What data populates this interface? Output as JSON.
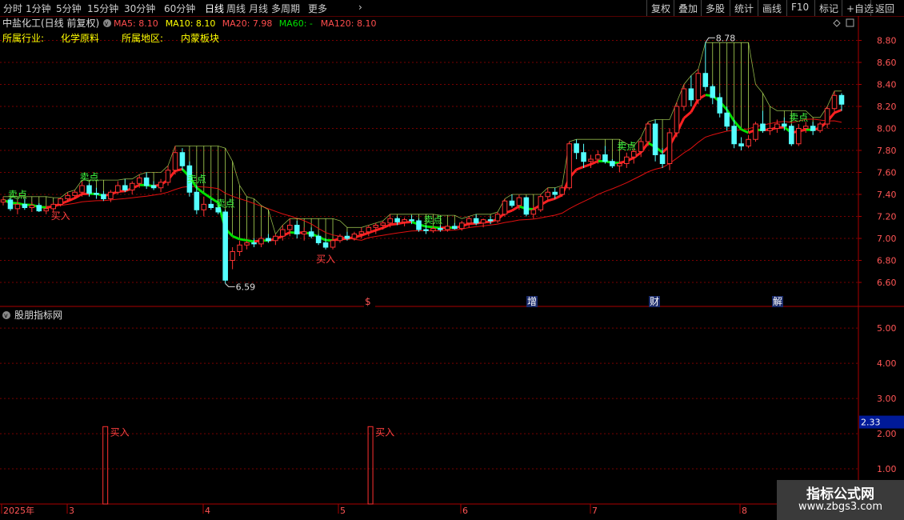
{
  "toolbar": {
    "left": [
      "分时",
      "1分钟",
      "5分钟",
      "15分钟",
      "30分钟",
      "60分钟",
      "日线",
      "周线",
      "月线",
      "多周期",
      "更多"
    ],
    "active": "日线",
    "right": [
      "复权",
      "叠加",
      "多股",
      "统计",
      "画线",
      "F10",
      "标记",
      "+自选",
      "返回"
    ]
  },
  "stock": {
    "title": "中盐化工(日线 前复权)"
  },
  "ma": [
    {
      "label": "MA5: 8.10",
      "color": "#ff4d4d"
    },
    {
      "label": "MA10: 8.10",
      "color": "#ffff00"
    },
    {
      "label": "MA20: 7.98",
      "color": "#ff4d4d"
    },
    {
      "label": "MA60: -",
      "color": "#00e000"
    },
    {
      "label": "MA120: 8.10",
      "color": "#ff4d4d"
    }
  ],
  "info": {
    "industry_label": "所属行业:",
    "industry": "化学原料",
    "region_label": "所属地区:",
    "region": "内蒙板块"
  },
  "price_axis": [
    "8.80",
    "8.60",
    "8.40",
    "8.20",
    "8.00",
    "7.80",
    "7.60",
    "7.40",
    "7.20",
    "7.00",
    "6.80",
    "6.60"
  ],
  "price_range": [
    6.52,
    8.92
  ],
  "high_label": "8.78",
  "low_label": "6.59",
  "signals": {
    "buy": "买入",
    "sell": "卖点"
  },
  "events": [
    "$",
    "增",
    "财",
    "解"
  ],
  "indicator": {
    "title": "股朋指标网",
    "axis": [
      "5.00",
      "4.00",
      "3.00",
      "2.00",
      "1.00"
    ],
    "range": [
      0,
      5.55
    ],
    "current": "2.33"
  },
  "time_axis": [
    "2025年",
    "3",
    "4",
    "5",
    "6",
    "7",
    "8"
  ],
  "watermark": {
    "line1": "指标公式网",
    "line2": "www.zbgs3.com"
  },
  "colors": {
    "up": "#ff3232",
    "down": "#54ffff",
    "ma_red": "#ff2020",
    "ma_green": "#00e000",
    "grid": "#7a0000",
    "band": "#ccff66"
  },
  "chart_data": {
    "type": "candlestick",
    "ohlc": [
      [
        7.33,
        7.38,
        7.3,
        7.35
      ],
      [
        7.35,
        7.37,
        7.25,
        7.27
      ],
      [
        7.27,
        7.34,
        7.22,
        7.31
      ],
      [
        7.31,
        7.36,
        7.26,
        7.28
      ],
      [
        7.28,
        7.33,
        7.24,
        7.3
      ],
      [
        7.3,
        7.32,
        7.24,
        7.25
      ],
      [
        7.25,
        7.28,
        7.22,
        7.27
      ],
      [
        7.27,
        7.33,
        7.24,
        7.31
      ],
      [
        7.31,
        7.37,
        7.29,
        7.36
      ],
      [
        7.36,
        7.42,
        7.33,
        7.39
      ],
      [
        7.39,
        7.44,
        7.36,
        7.42
      ],
      [
        7.42,
        7.53,
        7.38,
        7.48
      ],
      [
        7.48,
        7.5,
        7.38,
        7.41
      ],
      [
        7.41,
        7.46,
        7.36,
        7.4
      ],
      [
        7.4,
        7.43,
        7.34,
        7.36
      ],
      [
        7.36,
        7.44,
        7.33,
        7.42
      ],
      [
        7.42,
        7.52,
        7.4,
        7.48
      ],
      [
        7.48,
        7.54,
        7.42,
        7.44
      ],
      [
        7.44,
        7.52,
        7.4,
        7.5
      ],
      [
        7.5,
        7.58,
        7.46,
        7.55
      ],
      [
        7.55,
        7.6,
        7.45,
        7.48
      ],
      [
        7.48,
        7.52,
        7.44,
        7.46
      ],
      [
        7.46,
        7.54,
        7.42,
        7.51
      ],
      [
        7.51,
        7.66,
        7.48,
        7.62
      ],
      [
        7.62,
        7.84,
        7.58,
        7.78
      ],
      [
        7.78,
        7.82,
        7.62,
        7.66
      ],
      [
        7.66,
        7.7,
        7.38,
        7.42
      ],
      [
        7.42,
        7.48,
        7.22,
        7.26
      ],
      [
        7.26,
        7.38,
        7.2,
        7.31
      ],
      [
        7.31,
        7.36,
        7.26,
        7.28
      ],
      [
        7.28,
        7.3,
        7.22,
        7.24
      ],
      [
        7.24,
        7.26,
        6.59,
        6.62
      ],
      [
        6.8,
        6.92,
        6.72,
        6.88
      ],
      [
        6.88,
        6.98,
        6.84,
        6.94
      ],
      [
        6.94,
        6.98,
        6.9,
        6.96
      ],
      [
        6.96,
        7.0,
        6.92,
        6.95
      ],
      [
        6.95,
        7.02,
        6.92,
        7.0
      ],
      [
        7.0,
        7.04,
        6.96,
        6.98
      ],
      [
        6.98,
        7.04,
        6.94,
        7.02
      ],
      [
        7.02,
        7.12,
        6.98,
        7.08
      ],
      [
        7.08,
        7.18,
        7.02,
        7.12
      ],
      [
        7.12,
        7.16,
        7.0,
        7.04
      ],
      [
        7.04,
        7.1,
        6.98,
        7.06
      ],
      [
        7.06,
        7.1,
        7.0,
        7.02
      ],
      [
        7.02,
        7.04,
        6.94,
        6.96
      ],
      [
        6.96,
        7.0,
        6.9,
        6.92
      ],
      [
        6.92,
        7.0,
        6.9,
        6.98
      ],
      [
        6.98,
        7.04,
        6.96,
        7.02
      ],
      [
        7.02,
        7.06,
        6.98,
        7.0
      ],
      [
        7.0,
        7.06,
        6.98,
        7.04
      ],
      [
        7.04,
        7.1,
        7.0,
        7.06
      ],
      [
        7.06,
        7.12,
        7.02,
        7.1
      ],
      [
        7.1,
        7.14,
        7.04,
        7.12
      ],
      [
        7.12,
        7.16,
        7.08,
        7.14
      ],
      [
        7.14,
        7.22,
        7.1,
        7.18
      ],
      [
        7.18,
        7.2,
        7.12,
        7.15
      ],
      [
        7.15,
        7.19,
        7.11,
        7.17
      ],
      [
        7.17,
        7.21,
        7.13,
        7.16
      ],
      [
        7.16,
        7.18,
        7.06,
        7.08
      ],
      [
        7.08,
        7.12,
        7.04,
        7.07
      ],
      [
        7.07,
        7.11,
        7.05,
        7.09
      ],
      [
        7.09,
        7.12,
        7.06,
        7.08
      ],
      [
        7.08,
        7.12,
        7.06,
        7.11
      ],
      [
        7.11,
        7.14,
        7.08,
        7.09
      ],
      [
        7.09,
        7.16,
        7.07,
        7.14
      ],
      [
        7.14,
        7.2,
        7.1,
        7.18
      ],
      [
        7.18,
        7.22,
        7.12,
        7.14
      ],
      [
        7.14,
        7.18,
        7.1,
        7.17
      ],
      [
        7.17,
        7.2,
        7.13,
        7.16
      ],
      [
        7.16,
        7.24,
        7.14,
        7.22
      ],
      [
        7.22,
        7.36,
        7.2,
        7.34
      ],
      [
        7.34,
        7.4,
        7.28,
        7.3
      ],
      [
        7.3,
        7.4,
        7.26,
        7.37
      ],
      [
        7.37,
        7.38,
        7.2,
        7.22
      ],
      [
        7.22,
        7.3,
        7.18,
        7.26
      ],
      [
        7.26,
        7.4,
        7.24,
        7.38
      ],
      [
        7.38,
        7.46,
        7.34,
        7.42
      ],
      [
        7.42,
        7.46,
        7.36,
        7.4
      ],
      [
        7.4,
        7.48,
        7.38,
        7.46
      ],
      [
        7.46,
        7.88,
        7.44,
        7.86
      ],
      [
        7.86,
        7.9,
        7.72,
        7.78
      ],
      [
        7.78,
        7.86,
        7.64,
        7.7
      ],
      [
        7.7,
        7.76,
        7.64,
        7.72
      ],
      [
        7.72,
        7.8,
        7.68,
        7.76
      ],
      [
        7.76,
        7.84,
        7.68,
        7.7
      ],
      [
        7.7,
        7.72,
        7.64,
        7.66
      ],
      [
        7.66,
        7.7,
        7.6,
        7.68
      ],
      [
        7.68,
        7.78,
        7.64,
        7.74
      ],
      [
        7.74,
        7.82,
        7.68,
        7.79
      ],
      [
        7.79,
        7.92,
        7.74,
        7.88
      ],
      [
        7.88,
        8.06,
        7.84,
        8.04
      ],
      [
        8.04,
        8.08,
        7.7,
        7.76
      ],
      [
        7.76,
        7.82,
        7.64,
        7.68
      ],
      [
        7.68,
        8.0,
        7.62,
        7.96
      ],
      [
        7.96,
        8.24,
        7.92,
        8.2
      ],
      [
        8.2,
        8.4,
        8.16,
        8.36
      ],
      [
        8.36,
        8.48,
        8.2,
        8.26
      ],
      [
        8.26,
        8.54,
        8.22,
        8.5
      ],
      [
        8.5,
        8.78,
        8.34,
        8.38
      ],
      [
        8.38,
        8.4,
        8.22,
        8.28
      ],
      [
        8.28,
        8.32,
        8.1,
        8.14
      ],
      [
        8.14,
        8.2,
        7.98,
        8.02
      ],
      [
        8.02,
        8.08,
        7.82,
        7.86
      ],
      [
        7.86,
        7.92,
        7.8,
        7.84
      ],
      [
        7.84,
        7.94,
        7.82,
        7.9
      ],
      [
        7.9,
        8.06,
        7.88,
        8.04
      ],
      [
        8.04,
        8.16,
        7.96,
        7.98
      ],
      [
        7.98,
        8.04,
        7.94,
        8.0
      ],
      [
        8.0,
        8.08,
        7.96,
        8.04
      ],
      [
        8.04,
        8.1,
        7.98,
        8.02
      ],
      [
        8.02,
        8.04,
        7.84,
        7.86
      ],
      [
        7.86,
        8.04,
        7.84,
        8.0
      ],
      [
        8.0,
        8.06,
        7.96,
        8.02
      ],
      [
        8.02,
        8.06,
        7.94,
        7.98
      ],
      [
        7.98,
        8.06,
        7.96,
        8.04
      ],
      [
        8.04,
        8.2,
        8.0,
        8.18
      ],
      [
        8.18,
        8.34,
        8.14,
        8.3
      ],
      [
        8.3,
        8.32,
        8.16,
        8.22
      ]
    ],
    "buy_signal_bars": [
      8,
      45,
      127,
      137,
      187
    ],
    "sell_signal_bars": [
      2,
      12,
      27,
      31,
      60,
      87,
      111,
      119
    ],
    "indicator_bars": [
      {
        "index": 8,
        "value": 2.2
      },
      {
        "index": 45,
        "value": 2.2
      }
    ]
  }
}
